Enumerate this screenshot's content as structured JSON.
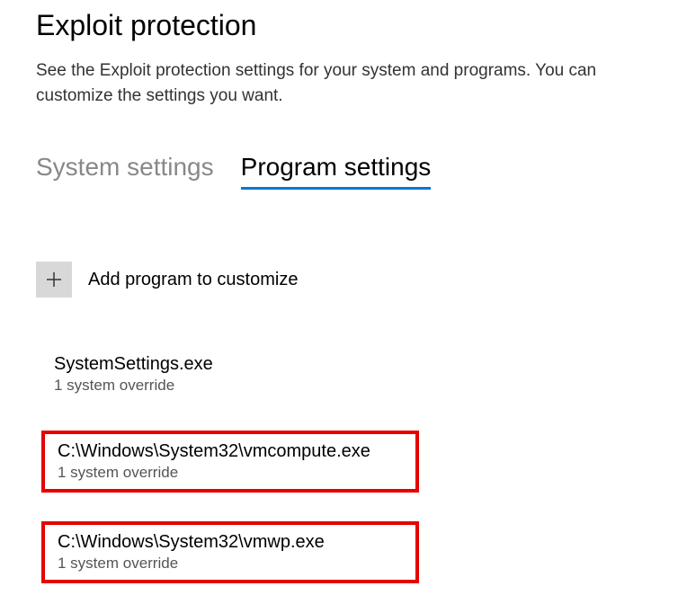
{
  "title": "Exploit protection",
  "description": "See the Exploit protection settings for your system and programs.  You can customize the settings you want.",
  "tabs": {
    "system": "System settings",
    "program": "Program settings"
  },
  "addProgram": {
    "label": "Add program to customize"
  },
  "programs": [
    {
      "name": "SystemSettings.exe",
      "sub": "1 system override"
    },
    {
      "name": "C:\\Windows\\System32\\vmcompute.exe",
      "sub": "1 system override"
    },
    {
      "name": "C:\\Windows\\System32\\vmwp.exe",
      "sub": "1 system override"
    }
  ]
}
